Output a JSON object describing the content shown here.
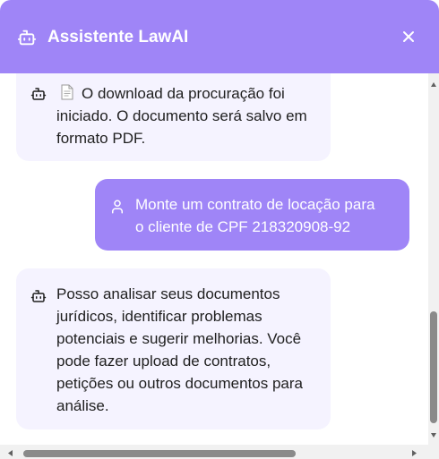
{
  "header": {
    "title": "Assistente LawAI",
    "icon": "robot-icon",
    "close_icon": "close-icon",
    "background": "#9f85f7"
  },
  "messages": [
    {
      "role": "bot",
      "icon": "robot-icon",
      "attachment_icon": "document-icon",
      "text": "O download da procuração foi\niniciado. O documento será salvo em\nformato PDF."
    },
    {
      "role": "user",
      "icon": "user-icon",
      "text": "Monte um contrato de locação para\no cliente de CPF 218320908-92"
    },
    {
      "role": "bot",
      "icon": "robot-icon",
      "text": "Posso analisar seus documentos\njurídicos, identificar problemas\npotenciais e sugerir melhorias. Você\npode fazer upload de contratos,\npetições ou outros documentos para\nanálise."
    }
  ],
  "colors": {
    "accent": "#9f85f7",
    "bot_bubble": "#f5f3ff"
  }
}
